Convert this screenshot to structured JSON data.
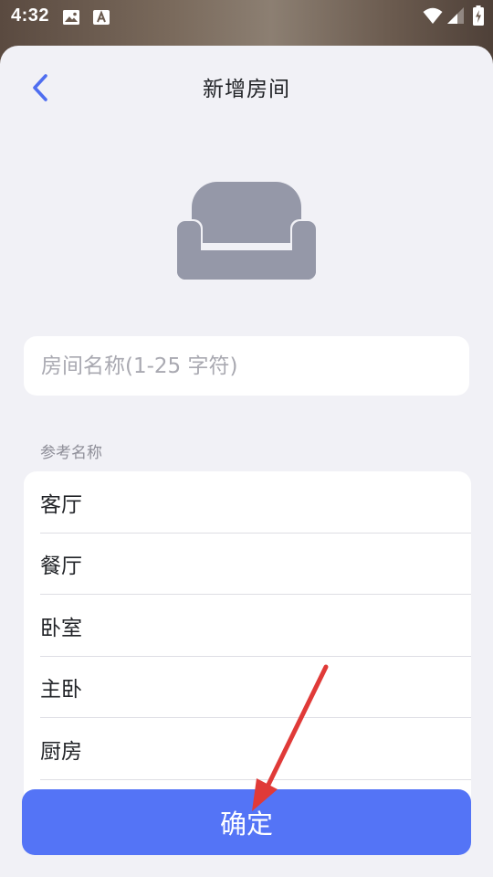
{
  "status_bar": {
    "time": "4:32",
    "icons": [
      "image-notification-icon",
      "app-a-notification-icon",
      "wifi-icon",
      "signal-icon",
      "battery-charging-icon"
    ]
  },
  "header": {
    "title": "新增房间",
    "back_icon": "chevron-left-icon"
  },
  "room_icon": "sofa-icon",
  "name_field": {
    "placeholder": "房间名称(1-25 字符)",
    "value": ""
  },
  "reference": {
    "label": "参考名称",
    "items": [
      {
        "label": "客厅"
      },
      {
        "label": "餐厅"
      },
      {
        "label": "卧室"
      },
      {
        "label": "主卧"
      },
      {
        "label": "厨房"
      },
      {
        "label": ""
      }
    ]
  },
  "confirm_label": "确定",
  "annotation": "red-arrow-pointing-at-confirm-button",
  "colors": {
    "accent": "#5474f6",
    "background": "#f1f1f6",
    "icon_gray": "#9598a8",
    "annotation_red": "#e03a38"
  }
}
